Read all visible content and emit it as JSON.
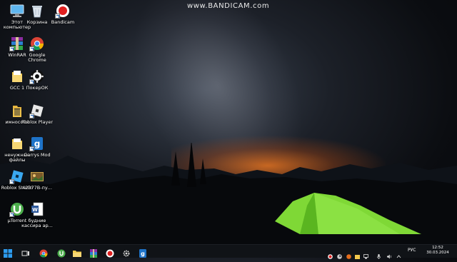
{
  "watermark": "www.BANDICAM.com",
  "desktop": {
    "icons": [
      {
        "label": "Этот компьютер",
        "icon": "computer-icon"
      },
      {
        "label": "Корзина",
        "icon": "recycle-bin-icon"
      },
      {
        "label": "Bandicam",
        "icon": "bandicam-icon"
      },
      {
        "label": "WinRAR",
        "icon": "winrar-icon"
      },
      {
        "label": "Google Chrome",
        "icon": "chrome-icon"
      },
      {
        "label": "GCC 1",
        "icon": "folder-icon"
      },
      {
        "label": "ПокерОК",
        "icon": "pokerok-icon"
      },
      {
        "label": "имнособи",
        "icon": "folder-icon"
      },
      {
        "label": "Roblox Player",
        "icon": "roblox-icon"
      },
      {
        "label": "ненужные файлы",
        "icon": "folder-icon"
      },
      {
        "label": "Garrys Mod",
        "icon": "garrysmod-icon"
      },
      {
        "label": "Roblox Studio",
        "icon": "roblox-studio-icon"
      },
      {
        "label": "42377B-пу...",
        "icon": "image-file-icon"
      },
      {
        "label": "µTorrent",
        "icon": "utorrent-icon"
      },
      {
        "label": "будние кассира ар...",
        "icon": "word-document-icon"
      }
    ]
  },
  "taskbar": {
    "items": [
      "start-icon",
      "task-view-icon",
      "chrome-icon",
      "utorrent-icon",
      "file-explorer-icon",
      "winrar-icon",
      "bandicam-icon",
      "settings-icon",
      "garrysmod-icon"
    ],
    "tray": [
      "bandicam-tray-icon",
      "steam-icon",
      "overwolf-icon",
      "folder-tray-icon",
      "network-icon",
      "microphone-icon",
      "volume-icon",
      "chevron-up-icon"
    ],
    "language": "РУС",
    "time": "12:52",
    "date": "30.03.2024"
  },
  "colors": {
    "taskbar": "#101317",
    "tent": "#7fd836",
    "glow": "#ff7a1e"
  }
}
